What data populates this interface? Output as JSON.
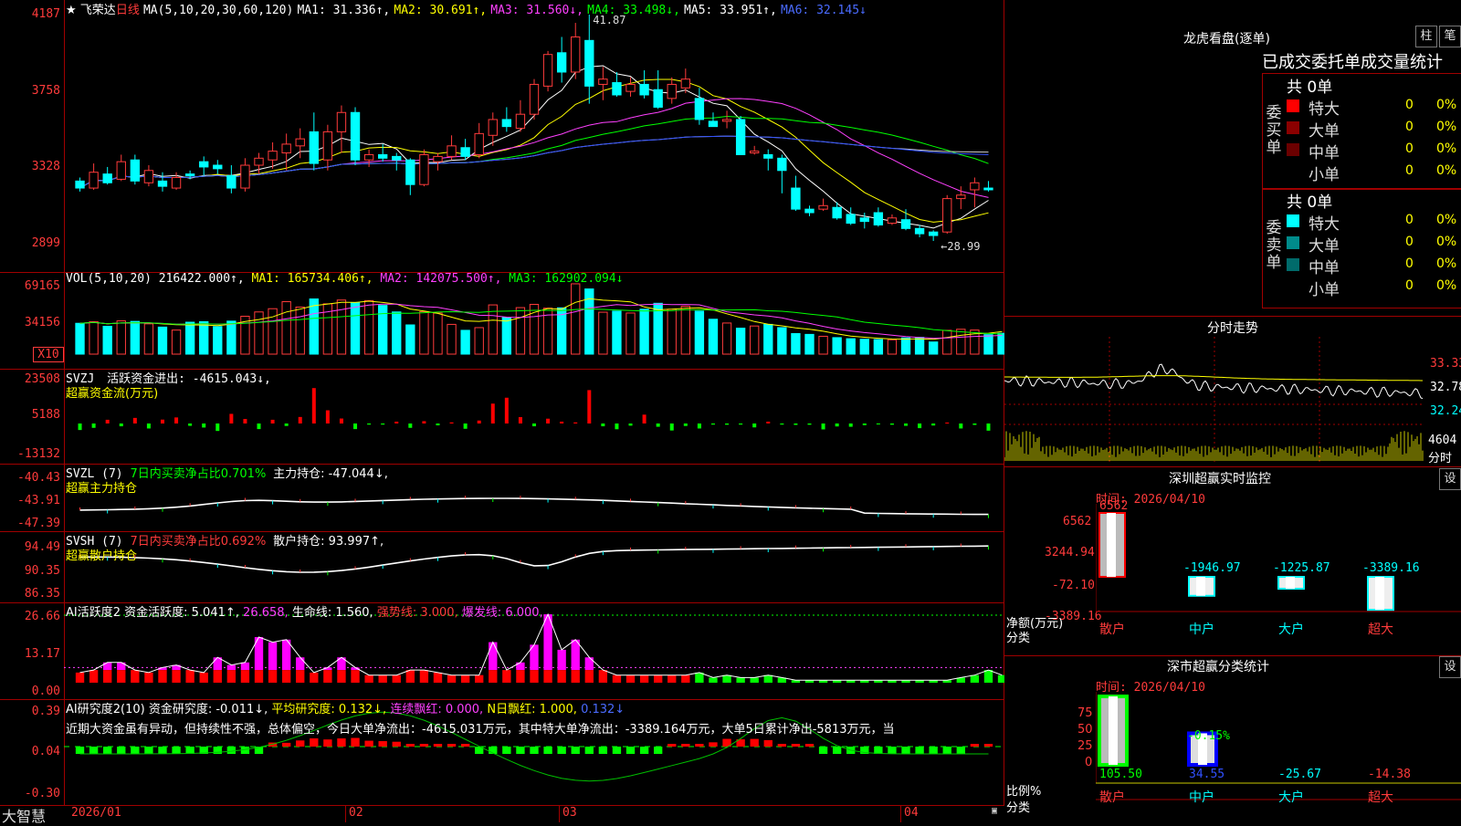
{
  "stock": {
    "star": "★",
    "name": "飞荣达",
    "period": "日线",
    "ma_label": "MA(5,10,20,30,60,120)",
    "ma1": "MA1: 31.336↑,",
    "ma2": "MA2: 30.691↑,",
    "ma3": "MA3: 31.560↓,",
    "ma4": "MA4: 33.498↓,",
    "ma5": "MA5: 33.951↑,",
    "ma6": "MA6: 32.145↓",
    "high_mark": "41.87",
    "low_mark": "28.99"
  },
  "price_axis": [
    "4187",
    "3758",
    "3328",
    "2899"
  ],
  "vol": {
    "label": "VOL(5,10,20)",
    "value": "216422.000↑,",
    "ma1": "MA1: 165734.406↑,",
    "ma2": "MA2: 142075.500↑,",
    "ma3": "MA3: 162902.094↓",
    "axis": [
      "69165",
      "34156"
    ],
    "unit": "X10"
  },
  "svzj": {
    "label": "SVZJ",
    "text": "活跃资金进出: -4615.043↓,",
    "sub": "超赢资金流(万元)",
    "axis": [
      "23508",
      "5188",
      "-13132"
    ]
  },
  "svzl": {
    "label": "SVZL (7)",
    "ratio": "7日内买卖净占比0.701%",
    "text": "主力持仓: -47.044↓,",
    "sub": "超赢主力持仓",
    "axis": [
      "-40.43",
      "-43.91",
      "-47.39"
    ]
  },
  "svsh": {
    "label": "SVSH (7)",
    "ratio": "7日内买卖净占比0.692%",
    "text": "散户持仓: 93.997↑,",
    "sub": "超赢散户持仓",
    "axis": [
      "94.49",
      "90.35",
      "86.35"
    ]
  },
  "ai1": {
    "label": "AI活跃度2",
    "t1": "资金活跃度: 5.041↑,",
    "t2": "26.658,",
    "t3": "生命线: 1.560,",
    "t4": "强势线: 3.000,",
    "t5": "爆发线: 6.000,",
    "axis": [
      "26.66",
      "13.17",
      "0.00"
    ]
  },
  "ai2": {
    "label": "AI研究度2(10)",
    "t1": "资金研究度: -0.011↓,",
    "t2": "平均研究度: 0.132↓,",
    "t3": "连续飘红: 0.000,",
    "t4": "N日飘红: 1.000,",
    "t5": "0.132↓",
    "comment": "近期大资金虽有异动，但持续性不强，总体偏空，今日大单净流出：-4615.031万元，其中特大单净流出：-3389.164万元，大单5日累计净出-5813万元，当",
    "axis": [
      "0.39",
      "0.04",
      "-0.30"
    ]
  },
  "date_axis": [
    "2026/01",
    "02",
    "03",
    "04"
  ],
  "brand": "大智慧",
  "right": {
    "lhkp_title": "龙虎看盘(逐单)",
    "btn_zhu": "柱",
    "btn_bi": "笔",
    "header": "已成交委托单成交量统计",
    "buy": {
      "side": [
        "委",
        "买",
        "单"
      ],
      "total": "共 0单",
      "rows": [
        {
          "label": "特大",
          "count": "0",
          "pct": "0%",
          "color": "#ff0000"
        },
        {
          "label": "大单",
          "count": "0",
          "pct": "0%",
          "color": "#8b0000"
        },
        {
          "label": "中单",
          "count": "0",
          "pct": "0%",
          "color": "#6b0000"
        },
        {
          "label": "小单",
          "count": "0",
          "pct": "0%",
          "color": "#000"
        }
      ]
    },
    "sell": {
      "side": [
        "委",
        "卖",
        "单"
      ],
      "total": "共 0单",
      "rows": [
        {
          "label": "特大",
          "count": "0",
          "pct": "0%",
          "color": "#00ffff"
        },
        {
          "label": "大单",
          "count": "0",
          "pct": "0%",
          "color": "#008b8b"
        },
        {
          "label": "中单",
          "count": "0",
          "pct": "0%",
          "color": "#006b6b"
        },
        {
          "label": "小单",
          "count": "0",
          "pct": "0%",
          "color": "#000"
        }
      ]
    },
    "fenshi": {
      "title": "分时走势",
      "axis": [
        "33.33",
        "32.78",
        "32.24"
      ],
      "vol": "4604",
      "unit": "分时"
    },
    "monitor": {
      "title": "深圳超赢实时监控",
      "btn": "设",
      "time": "时间: 2026/04/10",
      "axis": [
        "6562",
        "3244.94",
        "-72.10",
        "-3389.16"
      ],
      "ylabel": "净额(万元)",
      "xlabel": "分类",
      "cats": [
        "散户",
        "中户",
        "大户",
        "超大"
      ],
      "values": [
        "6562",
        "-1946.97",
        "-1225.87",
        "-3389.16"
      ]
    },
    "stats": {
      "title": "深市超赢分类统计",
      "btn": "设",
      "time": "时间: 2026/04/10",
      "axis": [
        "75",
        "50",
        "25",
        "0"
      ],
      "ylabel": "比例%",
      "xlabel": "分类",
      "cats": [
        "散户",
        "中户",
        "大户",
        "超大"
      ],
      "values": [
        "105.50",
        "34.55",
        "-25.67",
        "-14.38"
      ],
      "marker": "-0.15%"
    }
  },
  "colors": {
    "up": "#ff3b3b",
    "down": "#00ffff",
    "grid": "#a00000"
  },
  "chart_data": [
    {
      "type": "candlestick",
      "title": "飞荣达 日线",
      "ylim": [
        28.99,
        41.87
      ],
      "ohlc": [
        [
          32.4,
          32.6,
          31.8,
          32.0
        ],
        [
          32.0,
          33.4,
          31.9,
          32.9
        ],
        [
          32.8,
          33.2,
          32.2,
          32.3
        ],
        [
          32.5,
          33.9,
          32.4,
          33.5
        ],
        [
          33.6,
          33.9,
          32.2,
          32.4
        ],
        [
          32.3,
          33.3,
          32.1,
          33.0
        ],
        [
          32.4,
          32.9,
          31.8,
          32.1
        ],
        [
          32.0,
          32.9,
          31.9,
          32.6
        ],
        [
          32.8,
          33.0,
          32.5,
          32.7
        ],
        [
          33.5,
          33.8,
          32.7,
          33.2
        ],
        [
          33.3,
          33.6,
          32.8,
          33.1
        ],
        [
          32.7,
          33.3,
          31.7,
          32.0
        ],
        [
          32.0,
          33.7,
          31.8,
          33.3
        ],
        [
          33.3,
          34.0,
          32.8,
          33.7
        ],
        [
          33.6,
          34.6,
          33.1,
          34.1
        ],
        [
          34.0,
          35.1,
          33.0,
          34.5
        ],
        [
          34.4,
          35.4,
          33.7,
          34.8
        ],
        [
          35.2,
          36.3,
          33.0,
          33.4
        ],
        [
          33.6,
          35.6,
          33.0,
          35.2
        ],
        [
          35.2,
          36.7,
          34.0,
          36.3
        ],
        [
          36.3,
          36.6,
          33.3,
          33.6
        ],
        [
          33.6,
          34.2,
          33.2,
          33.9
        ],
        [
          33.9,
          34.5,
          33.5,
          33.7
        ],
        [
          33.8,
          34.0,
          33.0,
          33.6
        ],
        [
          33.6,
          33.7,
          31.6,
          32.2
        ],
        [
          32.2,
          34.2,
          32.1,
          33.9
        ],
        [
          33.5,
          34.0,
          33.0,
          33.8
        ],
        [
          33.8,
          35.0,
          33.6,
          34.4
        ],
        [
          34.3,
          34.8,
          33.6,
          33.8
        ],
        [
          33.9,
          35.7,
          33.7,
          35.1
        ],
        [
          35.0,
          36.3,
          34.4,
          35.9
        ],
        [
          35.9,
          36.6,
          35.2,
          35.5
        ],
        [
          35.4,
          37.0,
          35.2,
          36.2
        ],
        [
          36.2,
          38.2,
          35.9,
          37.9
        ],
        [
          37.8,
          39.8,
          37.5,
          39.6
        ],
        [
          39.7,
          40.6,
          38.0,
          38.6
        ],
        [
          38.6,
          41.4,
          38.2,
          40.6
        ],
        [
          40.4,
          41.87,
          36.8,
          37.8
        ],
        [
          37.9,
          38.9,
          37.0,
          38.2
        ],
        [
          38.0,
          38.6,
          37.2,
          37.3
        ],
        [
          37.5,
          38.3,
          37.2,
          37.9
        ],
        [
          37.9,
          38.7,
          37.1,
          37.3
        ],
        [
          37.6,
          38.7,
          36.5,
          36.6
        ],
        [
          37.1,
          38.3,
          36.8,
          37.9
        ],
        [
          37.7,
          38.8,
          37.4,
          38.2
        ],
        [
          37.1,
          37.7,
          35.6,
          35.9
        ],
        [
          35.8,
          36.3,
          35.5,
          35.5
        ],
        [
          35.8,
          36.4,
          35.4,
          35.9
        ],
        [
          35.9,
          36.1,
          33.9,
          33.9
        ],
        [
          34.0,
          34.4,
          33.9,
          34.1
        ],
        [
          33.9,
          34.2,
          33.0,
          33.7
        ],
        [
          33.7,
          33.9,
          31.7,
          33.0
        ],
        [
          32.0,
          32.7,
          30.7,
          30.8
        ],
        [
          30.8,
          31.0,
          30.4,
          30.6
        ],
        [
          30.8,
          31.4,
          30.7,
          31.0
        ],
        [
          30.9,
          31.2,
          30.2,
          30.3
        ],
        [
          30.5,
          30.9,
          29.9,
          30.0
        ],
        [
          30.3,
          30.6,
          29.7,
          30.1
        ],
        [
          30.6,
          30.9,
          29.8,
          29.9
        ],
        [
          30.0,
          30.5,
          29.9,
          30.3
        ],
        [
          30.2,
          30.8,
          29.6,
          29.7
        ],
        [
          29.7,
          29.9,
          29.2,
          29.4
        ],
        [
          29.5,
          29.6,
          28.99,
          29.3
        ],
        [
          29.5,
          31.6,
          29.4,
          31.4
        ],
        [
          31.4,
          32.1,
          30.8,
          31.6
        ],
        [
          31.9,
          32.6,
          30.9,
          32.3
        ],
        [
          32.0,
          32.4,
          31.8,
          31.9
        ]
      ]
    },
    {
      "type": "bar",
      "title": "VOL(5,10,20)",
      "values": [
        114000,
        120000,
        103000,
        123000,
        121000,
        112000,
        100000,
        89000,
        118000,
        120000,
        102000,
        122000,
        140000,
        156000,
        168000,
        194000,
        174000,
        204000,
        186000,
        200000,
        191000,
        198000,
        180000,
        156000,
        108000,
        157000,
        152000,
        110000,
        88000,
        98000,
        182000,
        135000,
        172000,
        184000,
        170000,
        171000,
        260000,
        241000,
        155000,
        159000,
        152000,
        166000,
        188000,
        166000,
        177000,
        159000,
        129000,
        115000,
        96000,
        104000,
        110000,
        98000,
        76000,
        73000,
        66000,
        61000,
        57000,
        55000,
        54000,
        53000,
        60000,
        62000,
        45000,
        88000,
        92000,
        89000,
        72000,
        77000
      ]
    },
    {
      "type": "bar",
      "title": "超赢资金流(万元)",
      "values": [
        -4200,
        -2800,
        2400,
        -1800,
        3600,
        -3200,
        2500,
        3900,
        -1500,
        -2600,
        -4800,
        6200,
        2900,
        -3600,
        2400,
        -1600,
        4200,
        22800,
        8500,
        3200,
        -3600,
        -700,
        -700,
        1200,
        -2800,
        1500,
        -1200,
        700,
        -3400,
        1900,
        12800,
        16600,
        4100,
        -1800,
        3100,
        1200,
        700,
        21500,
        -1800,
        -3700,
        -1400,
        5700,
        -2100,
        -4500,
        -1600,
        -3200,
        -700,
        -800,
        -700,
        -2500,
        1200,
        -700,
        -900,
        -800,
        -3800,
        -1900,
        -2100,
        -1100,
        -600,
        -800,
        -1500,
        -3000,
        -1300,
        600,
        -3200,
        -900,
        -4615
      ]
    },
    {
      "type": "line",
      "title": "超赢主力持仓",
      "ylim": [
        -47.39,
        -40.43
      ]
    },
    {
      "type": "line",
      "title": "超赢散户持仓",
      "ylim": [
        86.35,
        94.49
      ]
    },
    {
      "type": "bar",
      "title": "AI活跃度2",
      "ylim": [
        0,
        26.66
      ],
      "values": [
        4,
        5,
        8,
        8,
        5,
        4,
        6,
        7,
        5,
        4,
        10,
        7,
        8,
        18,
        16,
        17,
        10,
        4,
        6,
        10,
        6,
        3,
        3,
        3,
        5,
        5,
        4,
        3,
        3,
        3,
        16,
        5,
        8,
        15,
        27,
        13,
        17,
        10,
        5,
        3,
        3,
        3,
        3,
        3,
        3,
        4,
        2,
        3,
        2,
        2,
        3,
        2,
        1,
        1,
        1,
        1,
        1,
        1,
        1,
        1,
        1,
        1,
        1,
        1,
        2,
        3,
        5,
        3
      ]
    },
    {
      "type": "bar",
      "title": "AI研究度2(10)",
      "ylim": [
        -0.3,
        0.39
      ]
    },
    {
      "type": "bar",
      "title": "深圳超赢实时监控",
      "categories": [
        "散户",
        "中户",
        "大户",
        "超大"
      ],
      "values": [
        6562,
        -1946.97,
        -1225.87,
        -3389.16
      ]
    },
    {
      "type": "bar",
      "title": "深市超赢分类统计",
      "categories": [
        "散户",
        "中户",
        "大户",
        "超大"
      ],
      "values": [
        105.5,
        34.55,
        -25.67,
        -14.38
      ],
      "ylim": [
        0,
        75
      ]
    }
  ]
}
